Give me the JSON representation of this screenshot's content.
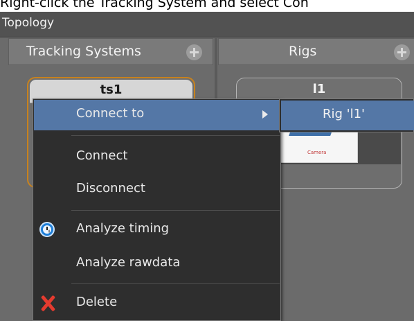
{
  "instruction": "Right-click the Tracking System and select Con",
  "window": {
    "title": "Topology"
  },
  "columns": {
    "tracking_systems": "Tracking Systems",
    "rigs": "Rigs"
  },
  "nodes": {
    "tracking_system": {
      "title": "ts1"
    },
    "rig": {
      "title": "l1",
      "thumbnail_label": "Camera"
    }
  },
  "context_menu": {
    "items": [
      {
        "label": "Connect to",
        "highlighted": true,
        "has_submenu": true
      },
      {
        "label": "Connect"
      },
      {
        "label": "Disconnect"
      },
      {
        "label": "Analyze timing",
        "icon": "clock-icon"
      },
      {
        "label": "Analyze rawdata"
      },
      {
        "label": "Delete",
        "icon": "delete-icon"
      }
    ]
  },
  "submenu": {
    "items": [
      {
        "label": "Rig 'l1'"
      }
    ]
  },
  "colors": {
    "highlight": "#5477a6",
    "selected_border": "#c8821e",
    "menu_background": "#2e2e2e"
  }
}
